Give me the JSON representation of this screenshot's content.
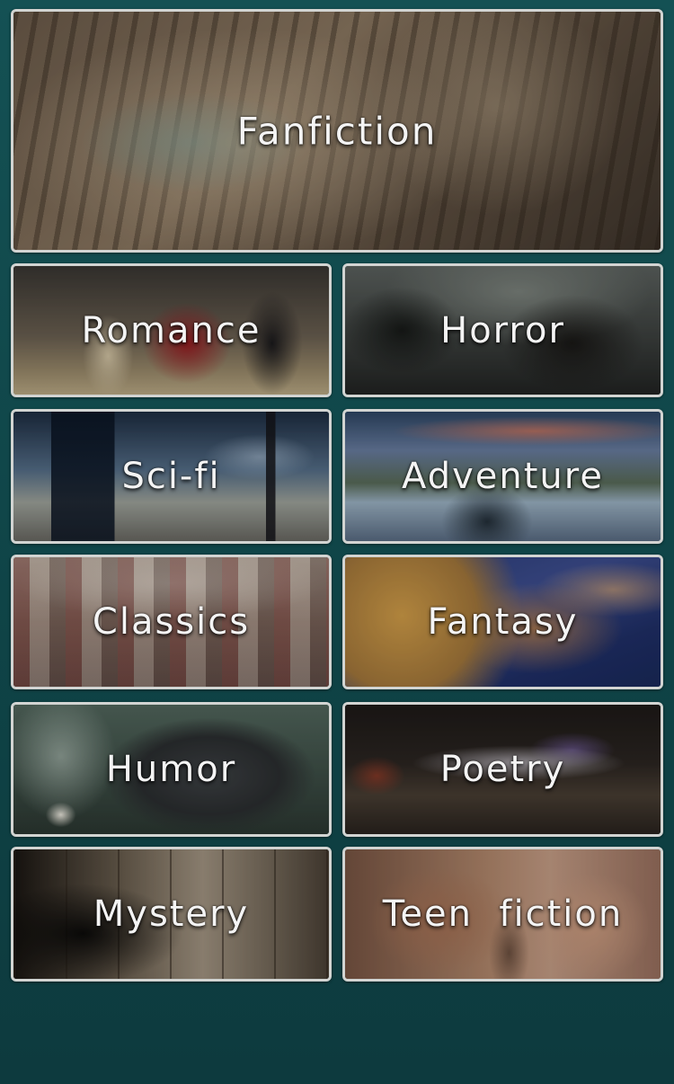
{
  "categories": [
    {
      "label": "Fanfiction",
      "art": "fanfiction-artwork"
    },
    {
      "label": "Romance",
      "art": "romance-artwork"
    },
    {
      "label": "Horror",
      "art": "horror-artwork"
    },
    {
      "label": "Sci-fi",
      "art": "scifi-artwork"
    },
    {
      "label": "Adventure",
      "art": "adventure-artwork"
    },
    {
      "label": "Classics",
      "art": "classics-artwork"
    },
    {
      "label": "Fantasy",
      "art": "fantasy-artwork"
    },
    {
      "label": "Humor",
      "art": "humor-artwork"
    },
    {
      "label": "Poetry",
      "art": "poetry-artwork"
    },
    {
      "label": "Mystery",
      "art": "mystery-artwork"
    },
    {
      "label": "Teen  fiction",
      "art": "teen-fiction-artwork"
    }
  ],
  "colors": {
    "background": "#145154",
    "tile_border": "#d2d4d2",
    "label_text": "#f4f4f4"
  }
}
